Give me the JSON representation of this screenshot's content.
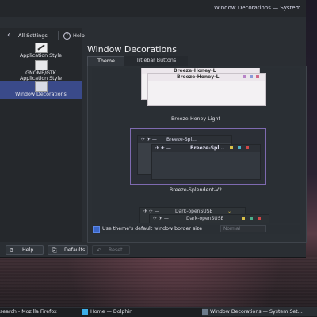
{
  "window": {
    "title": "Window Decorations — System Settings"
  },
  "topnav": {
    "all_settings": "All Settings",
    "help": "Help"
  },
  "sidebar": {
    "items": [
      {
        "label": "Application Style"
      },
      {
        "label": "GNOME/GTK Application Style"
      },
      {
        "label": "Window Decorations",
        "selected": true
      }
    ]
  },
  "page": {
    "title": "Window Decorations"
  },
  "tabs": [
    {
      "label": "Theme",
      "active": true
    },
    {
      "label": "Titlebar Buttons",
      "active": false
    }
  ],
  "themes": [
    {
      "name": "Breeze-Honey-Light",
      "preview_title": "Breeze-Honey-L"
    },
    {
      "name": "Breeze-Splendent-V2",
      "preview_title": "Breeze-Spl...",
      "selected": true
    },
    {
      "name": "Dark-openSUSE",
      "preview_title": "Dark-openSUSE"
    }
  ],
  "border_option": {
    "label": "Use theme's default window border size",
    "checked": true,
    "size_value": "Normal"
  },
  "buttons": {
    "help": "Help",
    "defaults": "Defaults",
    "reset": "Reset"
  },
  "taskbar": {
    "items": [
      {
        "label": "search - Mozilla Firefox"
      },
      {
        "label": "Home — Dolphin"
      },
      {
        "label": "Window Decorations — System Set..."
      }
    ]
  },
  "colors": {
    "accent": "#3a4a8a",
    "selection_border": "#7e6ab0",
    "checkbox": "#3b67c8"
  }
}
